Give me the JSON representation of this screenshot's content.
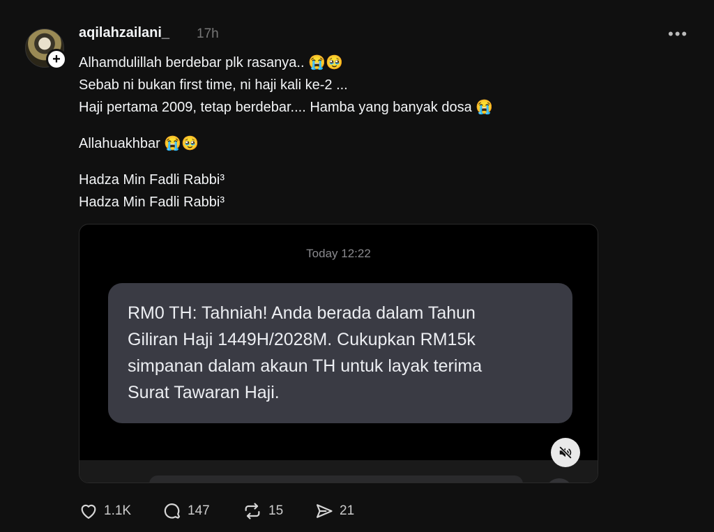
{
  "post": {
    "username": "aqilahzailani_",
    "time": "17h",
    "more": "•••",
    "caption": [
      "Alhamdulillah berdebar plk rasanya.. 😭🥹",
      "Sebab ni bukan first time, ni haji kali ke-2 ...",
      "Haji pertama 2009, tetap berdebar.... Hamba yang banyak dosa 😭",
      "",
      "Allahuakhbar 😭🥹",
      "",
      "Hadza Min Fadli Rabbi³",
      "Hadza Min Fadli Rabbi³"
    ]
  },
  "media": {
    "sms_time": "Today 12:22",
    "message": "RM0 TH: Tahniah! Anda berada dalam Tahun Giliran Haji 1449H/2028M. Cukupkan RM15k simpanan dalam akaun TH untuk layak terima Surat Tawaran Haji.",
    "message_lines": [
      "RM0 TH: Tahniah! Anda berada dalam Tahun",
      "Giliran Haji 1449H/2028M. Cukupkan RM15k",
      "simpanan dalam akaun TH untuk layak terima",
      "Surat Tawaran Haji."
    ],
    "mute_icon": "speaker-muted-icon"
  },
  "actions": {
    "likes": "1.1K",
    "comments": "147",
    "reposts": "15",
    "shares": "21",
    "icons": [
      "heart-icon",
      "comment-icon",
      "repost-icon",
      "share-icon"
    ]
  },
  "colors": {
    "background": "#101010",
    "bubble": "#3a3b44",
    "muted_text": "#777777"
  }
}
